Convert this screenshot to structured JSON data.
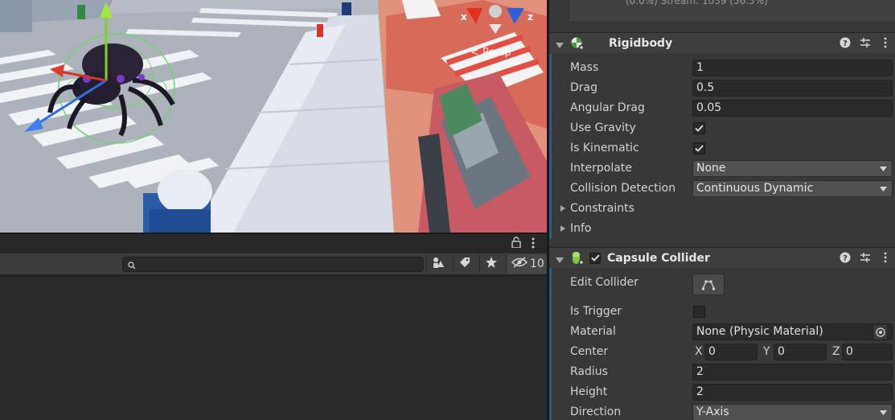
{
  "scene": {
    "axis_x": "x",
    "axis_z": "z",
    "view_mode_label": "< Persp"
  },
  "lower_panel": {
    "search_placeholder": "",
    "hidden_count": "10"
  },
  "inspector": {
    "stats_text": "(0.0%) Stream: 1039 (56.5%)",
    "rigidbody": {
      "title": "Rigidbody",
      "mass_label": "Mass",
      "mass": "1",
      "drag_label": "Drag",
      "drag": "0.5",
      "angular_drag_label": "Angular Drag",
      "angular_drag": "0.05",
      "use_gravity_label": "Use Gravity",
      "use_gravity": true,
      "is_kinematic_label": "Is Kinematic",
      "is_kinematic": true,
      "interpolate_label": "Interpolate",
      "interpolate": "None",
      "collision_detection_label": "Collision Detection",
      "collision_detection": "Continuous Dynamic",
      "constraints_label": "Constraints",
      "info_label": "Info"
    },
    "capsule_collider": {
      "title": "Capsule Collider",
      "enabled": true,
      "edit_collider_label": "Edit Collider",
      "is_trigger_label": "Is Trigger",
      "is_trigger": false,
      "material_label": "Material",
      "material": "None (Physic Material)",
      "center_label": "Center",
      "center": {
        "x_label": "X",
        "x": "0",
        "y_label": "Y",
        "y": "0",
        "z_label": "Z",
        "z": "0"
      },
      "radius_label": "Radius",
      "radius": "2",
      "height_label": "Height",
      "height": "2",
      "direction_label": "Direction",
      "direction": "Y-Axis"
    }
  },
  "colors": {
    "panel_bg": "#383838",
    "field_bg": "#2a2a2a",
    "header_bg": "#3e3e3e",
    "selection_blue": "#2c5d87"
  }
}
